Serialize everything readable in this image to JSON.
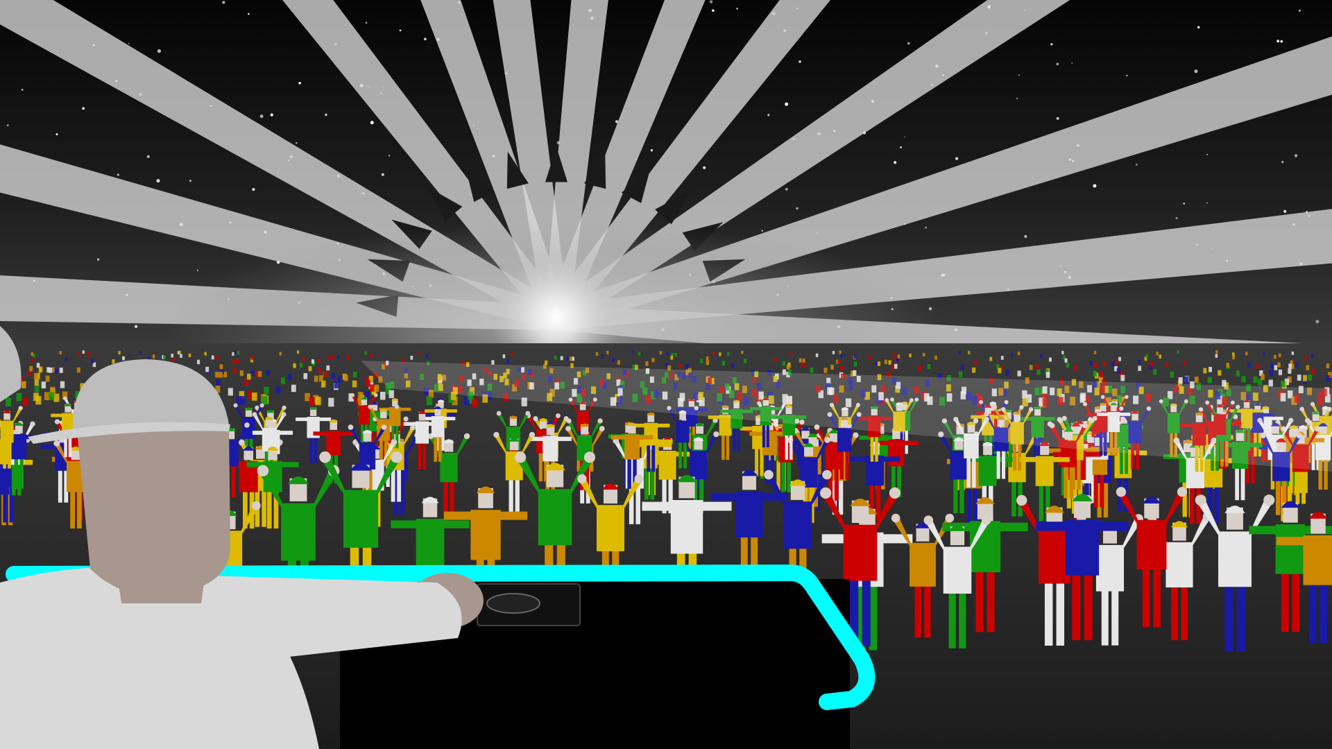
{
  "scene": {
    "kind": "3d-rave-concert-scene",
    "description_visible_text": "",
    "colors": {
      "sky_top": "#0a0a0a",
      "sky_bottom": "#3a3a3a",
      "light_beam": "#d8d8d8",
      "stage_light_glow": "#ffffff",
      "floor": "#2a2a2a",
      "dj_desk": "#000000",
      "dj_desk_edge": "#00ffff",
      "dj_body": "#d9d9d9",
      "dj_skin": "#a8978f",
      "dj_cap": "#bdbdbd",
      "crowd_red": "#cc0000",
      "crowd_green": "#119911",
      "crowd_blue": "#1a1aa8",
      "crowd_yellow": "#ddbb00",
      "crowd_white": "#e6e6e6",
      "crowd_orange": "#cc8800",
      "crowd_skin": "#d9cfc9"
    },
    "icons": {
      "turntable": "turntable-icon",
      "sparkle": "star-particle"
    }
  }
}
